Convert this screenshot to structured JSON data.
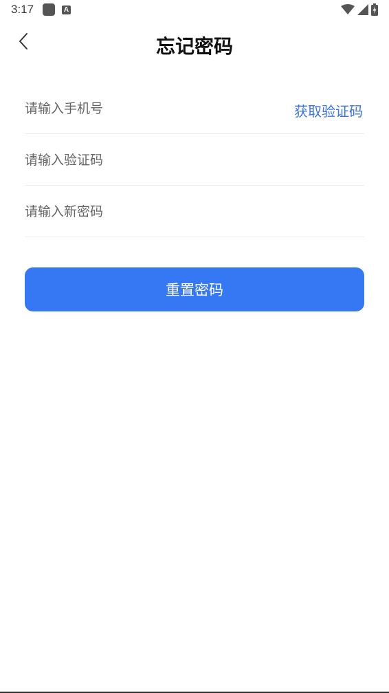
{
  "status_bar": {
    "time": "3:17",
    "icons": [
      "app-notification-icon",
      "a-notification-icon",
      "wifi-icon",
      "signal-icon",
      "battery-charging-icon"
    ],
    "a_icon_text": "A"
  },
  "header": {
    "title": "忘记密码",
    "back_icon": "chevron-left-icon"
  },
  "form": {
    "phone_placeholder": "请输入手机号",
    "phone_value": "",
    "get_code_label": "获取验证码",
    "code_placeholder": "请输入验证码",
    "code_value": "",
    "password_placeholder": "请输入新密码",
    "password_value": ""
  },
  "actions": {
    "reset_label": "重置密码"
  },
  "colors": {
    "accent": "#3677f3",
    "link": "#3a73e8",
    "divider": "#ececec"
  }
}
